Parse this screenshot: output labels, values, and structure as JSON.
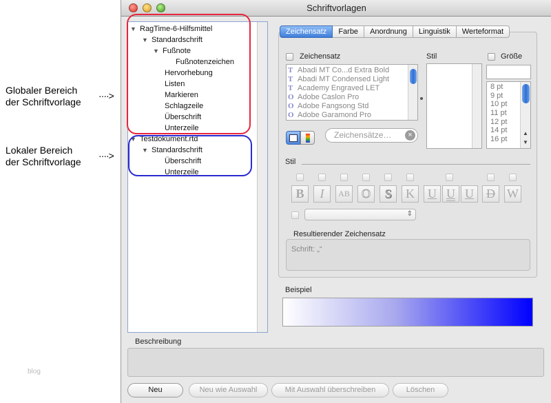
{
  "annotations": {
    "global_label_line1": "Globaler Bereich",
    "global_label_line2": "der Schriftvorlage",
    "local_label_line1": "Lokaler Bereich",
    "local_label_line2": "der Schriftvorlage",
    "arrow": "····>",
    "watermark": "blog",
    "global_box_color": "#e8243c",
    "local_box_color": "#2a2ad0"
  },
  "window": {
    "title": "Schriftvorlagen"
  },
  "tree": {
    "items": [
      {
        "label": "RagTime-6-Hilfsmittel",
        "toggle": "▼"
      },
      {
        "label": "Standardschrift",
        "toggle": "▼"
      },
      {
        "label": "Fußnote",
        "toggle": "▼"
      },
      {
        "label": "Fußnotenzeichen",
        "toggle": ""
      },
      {
        "label": "Hervorhebung",
        "toggle": ""
      },
      {
        "label": "Listen",
        "toggle": ""
      },
      {
        "label": "Markieren",
        "toggle": ""
      },
      {
        "label": "Schlagzeile",
        "toggle": ""
      },
      {
        "label": "Überschrift",
        "toggle": ""
      },
      {
        "label": "Unterzeile",
        "toggle": ""
      },
      {
        "label": "Testdokument.rtd",
        "toggle": "▼"
      },
      {
        "label": "Standardschrift",
        "toggle": "▼"
      },
      {
        "label": "Überschrift",
        "toggle": ""
      },
      {
        "label": "Unterzeile",
        "toggle": ""
      }
    ]
  },
  "tabs": [
    {
      "label": "Zeichensatz",
      "active": true
    },
    {
      "label": "Farbe",
      "active": false
    },
    {
      "label": "Anordnung",
      "active": false
    },
    {
      "label": "Linguistik",
      "active": false
    },
    {
      "label": "Werteformat",
      "active": false
    }
  ],
  "zeichensatz": {
    "label": "Zeichensatz",
    "fonts": [
      {
        "name": "Abadi MT Co...d Extra Bold",
        "icon": "T"
      },
      {
        "name": "Abadi MT Condensed Light",
        "icon": "T"
      },
      {
        "name": "Academy Engraved LET",
        "icon": "T"
      },
      {
        "name": "Adobe Caslon Pro",
        "icon": "O"
      },
      {
        "name": "Adobe Fangsong Std",
        "icon": "O"
      },
      {
        "name": "Adobe Garamond Pro",
        "icon": "O"
      }
    ],
    "search_placeholder": "Zeichensätze…",
    "clear_glyph": "×"
  },
  "stil_list": {
    "label": "Stil"
  },
  "groesse": {
    "label": "Größe",
    "sizes": [
      "8 pt",
      "9 pt",
      "10 pt",
      "11 pt",
      "12 pt",
      "14 pt",
      "16 pt"
    ],
    "scroll_up": "▲",
    "scroll_down": "▼"
  },
  "stil": {
    "label": "Stil",
    "buttons": [
      {
        "glyph": "B",
        "name": "bold-button"
      },
      {
        "glyph": "I",
        "name": "italic-button"
      },
      {
        "glyph": "AB",
        "name": "small-caps-button"
      },
      {
        "glyph": "O",
        "name": "outline-button"
      },
      {
        "glyph": "S",
        "name": "shadow-button"
      },
      {
        "glyph": "K",
        "name": "kerning-button"
      },
      {
        "glyph": "U",
        "name": "underline-button"
      },
      {
        "glyph": "U",
        "name": "double-underline-button"
      },
      {
        "glyph": "U",
        "name": "word-underline-button"
      },
      {
        "glyph": "D",
        "name": "strikethrough-button"
      },
      {
        "glyph": "W",
        "name": "wide-button"
      }
    ],
    "popup_arrows": "⇕"
  },
  "resultierender": {
    "label": "Resultierender Zeichensatz",
    "value": "Schrift: „“"
  },
  "beispiel": {
    "label": "Beispiel"
  },
  "beschreibung": {
    "label": "Beschreibung"
  },
  "buttons": {
    "neu": "Neu",
    "neu_wie_auswahl": "Neu wie Auswahl",
    "mit_auswahl": "Mit Auswahl überschreiben",
    "loeschen": "Löschen"
  }
}
